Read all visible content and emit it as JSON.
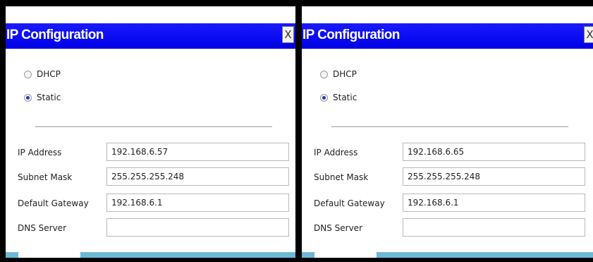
{
  "panels": [
    {
      "title": "IP Configuration",
      "close_label": "X",
      "mode_options": [
        {
          "label": "DHCP",
          "selected": false
        },
        {
          "label": "Static",
          "selected": true
        }
      ],
      "fields": [
        {
          "label": "IP Address",
          "value": "192.168.6.57"
        },
        {
          "label": "Subnet Mask",
          "value": "255.255.255.248"
        },
        {
          "label": "Default Gateway",
          "value": "192.168.6.1"
        },
        {
          "label": "DNS Server",
          "value": ""
        }
      ]
    },
    {
      "title": "IP Configuration",
      "close_label": "X",
      "mode_options": [
        {
          "label": "DHCP",
          "selected": false
        },
        {
          "label": "Static",
          "selected": true
        }
      ],
      "fields": [
        {
          "label": "IP Address",
          "value": "192.168.6.65"
        },
        {
          "label": "Subnet Mask",
          "value": "255.255.255.248"
        },
        {
          "label": "Default Gateway",
          "value": "192.168.6.1"
        },
        {
          "label": "DNS Server",
          "value": ""
        }
      ]
    }
  ],
  "colors": {
    "titlebar": "#0000e6",
    "background": "#000000",
    "bottom_bar": "#6cb8d4",
    "radio_dot": "#1b3fa8"
  }
}
